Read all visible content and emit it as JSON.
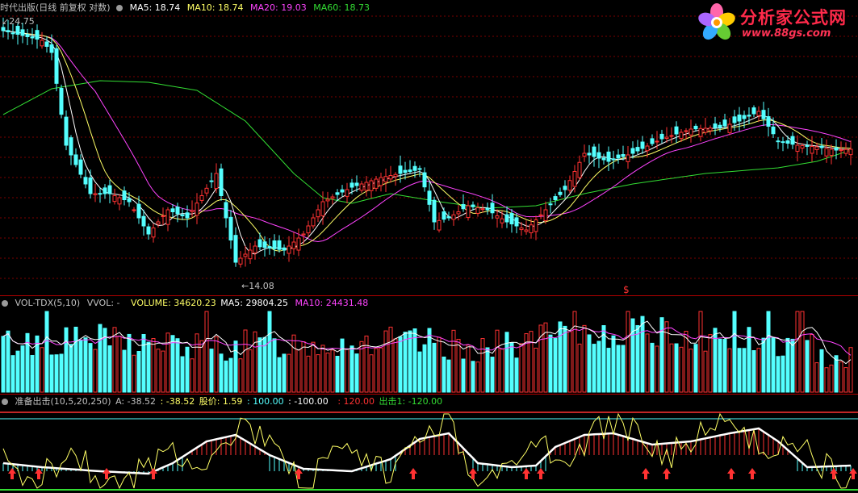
{
  "logo": {
    "name": "分析家公式网",
    "url": "www.88gs.com",
    "icon": "flower-logo-icon"
  },
  "main_panel": {
    "title": "时代出版(日线 前复权 对数)",
    "legend": [
      {
        "label": "MA5: 18.74",
        "color": "#ffffff"
      },
      {
        "label": "MA10: 18.74",
        "color": "#ffff66"
      },
      {
        "label": "MA20: 19.03",
        "color": "#ff44ff"
      },
      {
        "label": "MA60: 18.73",
        "color": "#33dd33"
      }
    ],
    "high_marker": "24.75",
    "low_marker": "14.08",
    "event_marker": "$",
    "colors": {
      "up": "#ff3232",
      "down": "#54ffff",
      "grid": "#7a0000"
    }
  },
  "volume_panel": {
    "legend": [
      {
        "label": "VOL-TDX(5,10)",
        "color": "#c0c0c0"
      },
      {
        "label": "VVOL: -",
        "color": "#c0c0c0"
      },
      {
        "label": "VOLUME: 34620.23",
        "color": "#ffff66"
      },
      {
        "label": "MA5: 29804.25",
        "color": "#ffffff"
      },
      {
        "label": "MA10: 24431.48",
        "color": "#ff44ff"
      }
    ]
  },
  "indicator_panel": {
    "legend": [
      {
        "label": "准备出击(10,5,20,250)",
        "color": "#c0c0c0"
      },
      {
        "label": "A: -38.52",
        "color": "#c0c0c0"
      },
      {
        "label": ": -38.52",
        "color": "#ffff66"
      },
      {
        "label": "股价: 1.59",
        "color": "#ffff66"
      },
      {
        "label": ": 100.00",
        "color": "#54ffff"
      },
      {
        "label": ": -100.00",
        "color": "#ffffff"
      },
      {
        "label": ": 120.00",
        "color": "#ff3232"
      },
      {
        "label": "出击1: -120.00",
        "color": "#33dd33"
      }
    ]
  }
}
